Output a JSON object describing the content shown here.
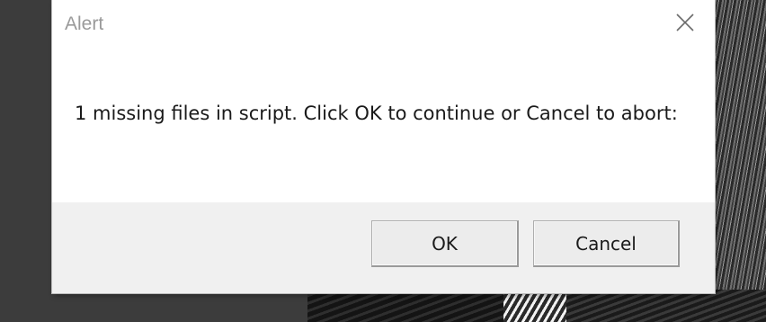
{
  "dialog": {
    "title": "Alert",
    "message": "1 missing files in script. Click OK to continue or Cancel to abort:",
    "close_icon": "close-icon",
    "buttons": {
      "ok_label": "OK",
      "cancel_label": "Cancel"
    }
  },
  "colors": {
    "dialog_background": "#ffffff",
    "footer_background": "#f0f0f0",
    "title_text": "#9a9a9a",
    "message_text": "#1a1a1a",
    "desktop_background": "#3c3c3c"
  }
}
